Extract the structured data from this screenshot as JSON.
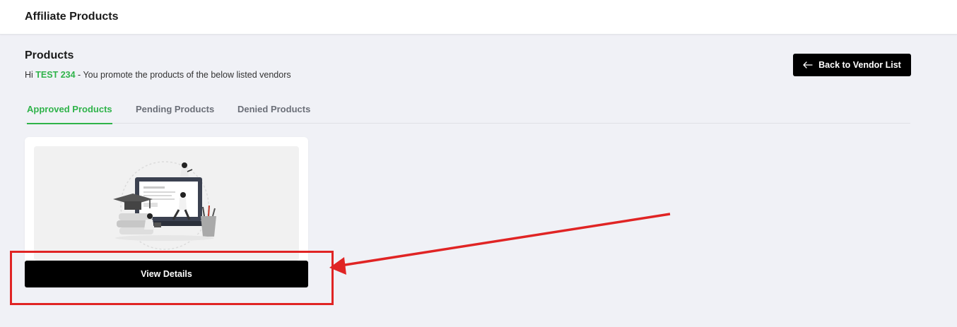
{
  "header": {
    "title": "Affiliate Products"
  },
  "section": {
    "title": "Products",
    "greeting_prefix": "Hi ",
    "user_name": "TEST 234",
    "greeting_suffix": " - You promote the products of the below listed vendors"
  },
  "back_button": {
    "label": "Back to Vendor List",
    "icon": "arrow-left-icon"
  },
  "tabs": [
    {
      "label": "Approved Products",
      "active": true
    },
    {
      "label": "Pending Products",
      "active": false
    },
    {
      "label": "Denied Products",
      "active": false
    }
  ],
  "card": {
    "image": "e-learning-illustration",
    "button_label": "View Details"
  },
  "colors": {
    "accent": "#2fb34a",
    "button": "#000000",
    "background": "#f0f1f6",
    "annotation": "#e02424"
  }
}
